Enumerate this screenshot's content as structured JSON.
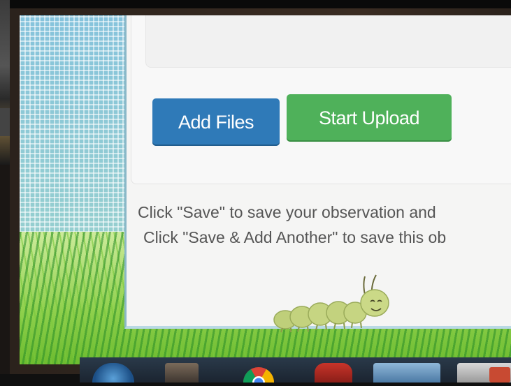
{
  "upload": {
    "add_files_label": "Add Files",
    "start_upload_label": "Start Upload"
  },
  "instructions": {
    "line1": "Click \"Save\" to save your observation and",
    "line2": "Click \"Save & Add Another\" to save this ob"
  },
  "colors": {
    "add_files_button": "#2f7ab8",
    "start_upload_button": "#4fb15a",
    "panel_background": "#f5f5f4",
    "grass": "#8fd04c"
  },
  "icons": {
    "mascot": "caterpillar-icon",
    "taskbar": [
      "windows-start-icon",
      "media-player-icon",
      "chrome-icon",
      "paint-icon",
      "internet-explorer-icon",
      "powerpoint-icon"
    ]
  }
}
